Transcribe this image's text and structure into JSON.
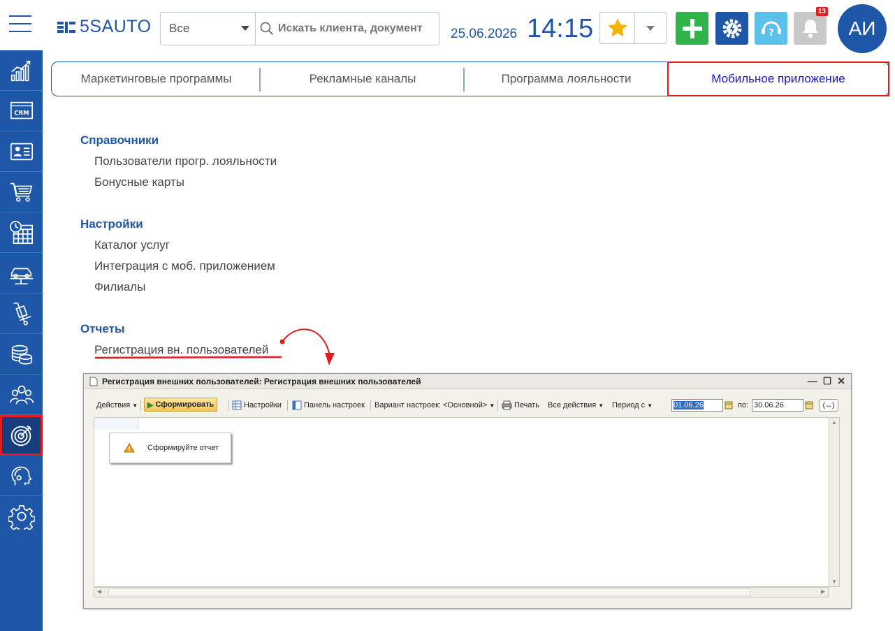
{
  "header": {
    "brand": "5SAUTO",
    "search_scope": "Все",
    "search_placeholder": "Искать клиента, документ",
    "date": "25.06.2026",
    "time": "14:15",
    "notifications_count": "13",
    "avatar_initials": "АИ",
    "accent_color": "#1f57a8"
  },
  "sidebar": {
    "icons": [
      "analytics-chart-icon",
      "crm-icon",
      "contacts-card-icon",
      "cart-icon",
      "schedule-icon",
      "car-lift-icon",
      "parts-icon",
      "finance-coins-icon",
      "staff-icon",
      "marketing-target-icon",
      "support-agent-icon",
      "settings-gear-icon"
    ],
    "active_index": 9
  },
  "tabs": [
    {
      "label": "Маркетинговые программы"
    },
    {
      "label": "Рекламные каналы"
    },
    {
      "label": "Программа лояльности"
    },
    {
      "label": "Мобильное приложение"
    }
  ],
  "sections": [
    {
      "title": "Справочники",
      "items": [
        "Пользователи прогр. лояльности",
        "Бонусные карты"
      ]
    },
    {
      "title": "Настройки",
      "items": [
        "Каталог услуг",
        "Интеграция с моб. приложением",
        "Филиалы"
      ]
    },
    {
      "title": "Отчеты",
      "items": [
        "Регистрация вн. пользователей"
      ]
    }
  ],
  "window": {
    "title": "Регистрация внешних пользователей: Регистрация внешних пользователей",
    "toolbar": {
      "actions": "Действия",
      "generate": "Сформировать",
      "settings": "Настройки",
      "settings_panel": "Панель настроек",
      "variant": "Вариант настроек: <Основной>",
      "print": "Печать",
      "all_actions": "Все действия",
      "period": "Период с",
      "date_from": "01.06.26",
      "to_label": "по:",
      "date_to": "30.06.26",
      "period_btn": "(↔)"
    },
    "warning": "Сформируйте отчет"
  }
}
